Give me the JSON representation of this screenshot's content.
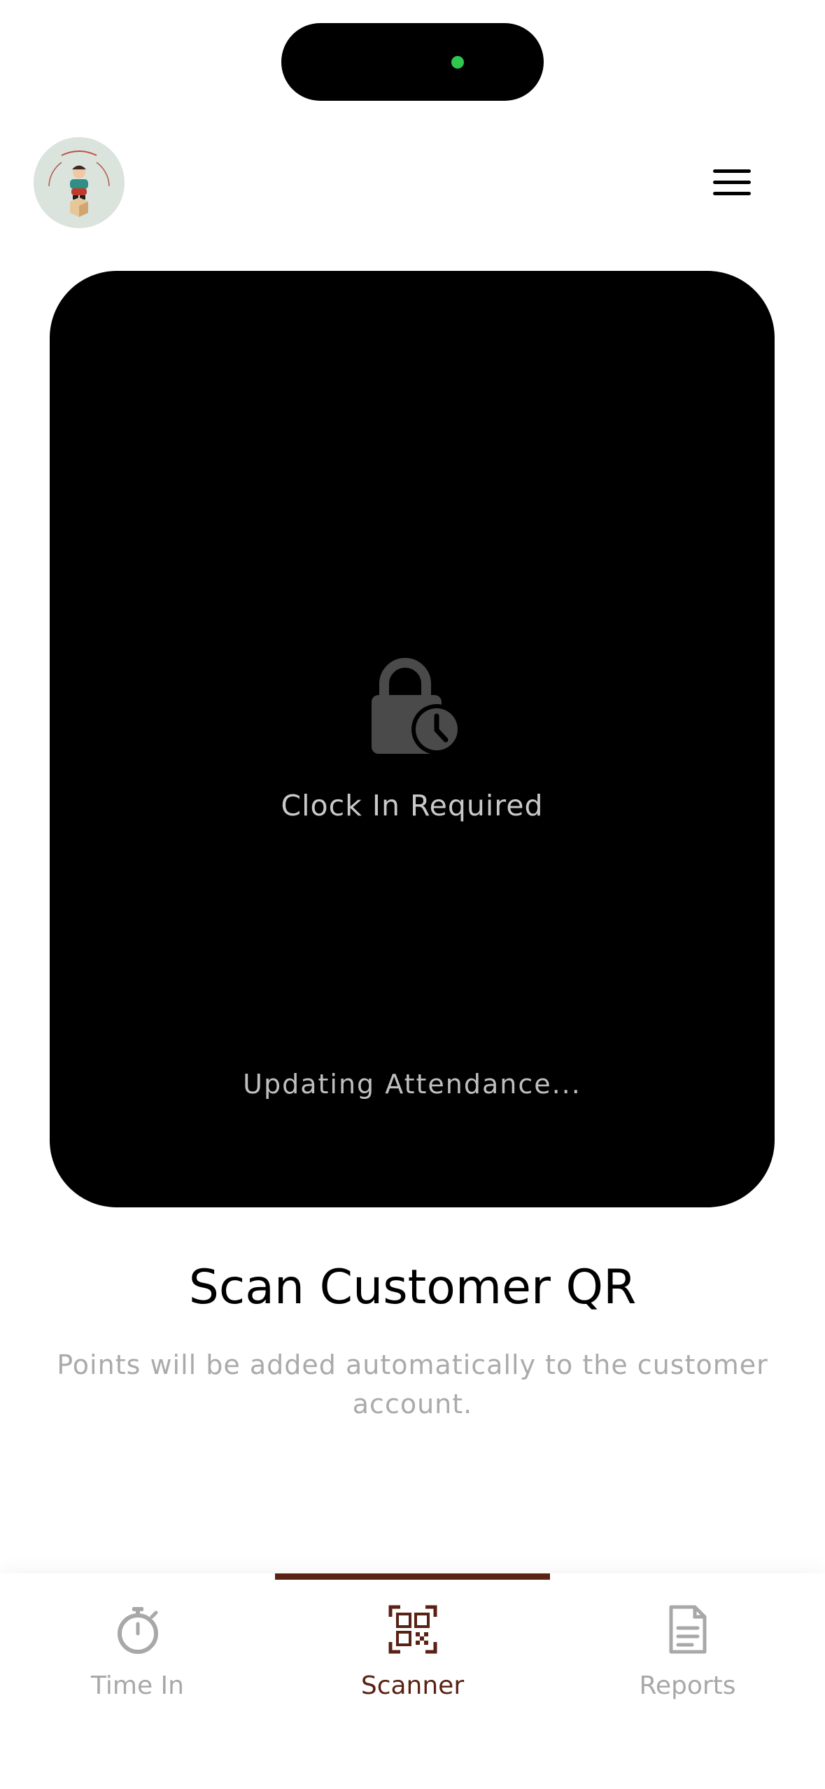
{
  "app": {
    "logo_alt": "Dewy Sulky logo"
  },
  "header": {
    "menu_icon": "hamburger-menu-icon"
  },
  "scanner": {
    "lock_icon": "lock-clock-icon",
    "lock_label": "Clock In Required",
    "status_text": "Updating Attendance..."
  },
  "main": {
    "title": "Scan Customer QR",
    "subtitle": "Points will be added automatically to the customer account."
  },
  "bottom_nav": {
    "active_color": "#5a2214",
    "inactive_color": "#a8a8a8",
    "items": [
      {
        "label": "Time In",
        "icon": "stopwatch-icon",
        "active": false
      },
      {
        "label": "Scanner",
        "icon": "qr-code-icon",
        "active": true
      },
      {
        "label": "Reports",
        "icon": "document-icon",
        "active": false
      }
    ]
  },
  "colors": {
    "scanner_background": "#000000",
    "status_dot": "#2fc74f"
  }
}
